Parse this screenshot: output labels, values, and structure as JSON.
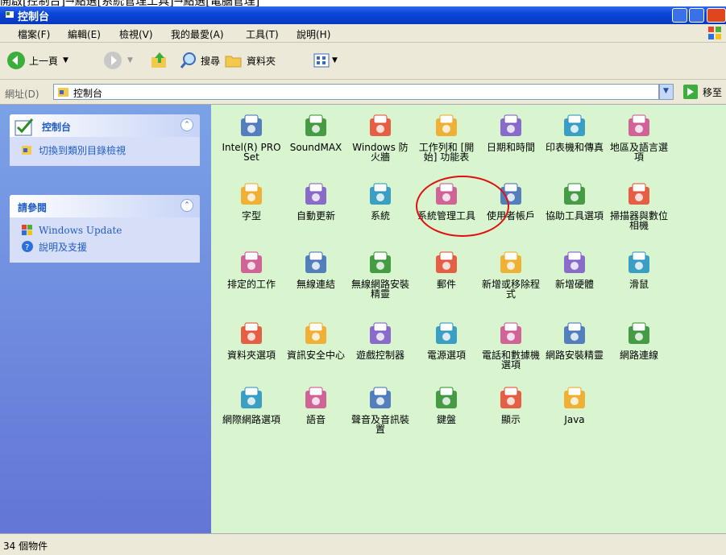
{
  "caption": "開啟[控制台]→點選[系統管理工具]→點選[電腦管理]",
  "window": {
    "title": "控制台"
  },
  "menu": [
    "檔案(F)",
    "編輯(E)",
    "檢視(V)",
    "我的最愛(A)",
    "工具(T)",
    "說明(H)"
  ],
  "toolbar": {
    "back": "上一頁",
    "search": "搜尋",
    "folders": "資料夾"
  },
  "address": {
    "label": "網址(D)",
    "value": "控制台",
    "go": "移至"
  },
  "left": {
    "panel1": {
      "title": "控制台",
      "tasks": [
        "切換到類別目錄檢視"
      ]
    },
    "panel2": {
      "title": "請參閱",
      "tasks": [
        "Windows Update",
        "說明及支援"
      ]
    }
  },
  "icons": [
    [
      "Intel(R) PROSet",
      "SoundMAX",
      "Windows 防火牆",
      "工作列和 [開始] 功能表",
      "日期和時間",
      "印表機和傳真",
      "地區及語言選項"
    ],
    [
      "字型",
      "自動更新",
      "系統",
      "系統管理工具",
      "使用者帳戶",
      "協助工具選項",
      "掃描器與數位相機"
    ],
    [
      "排定的工作",
      "無線連結",
      "無線網路安裝精靈",
      "郵件",
      "新增或移除程式",
      "新增硬體",
      "滑鼠"
    ],
    [
      "資料夾選項",
      "資訊安全中心",
      "遊戲控制器",
      "電源選項",
      "電話和數據機選項",
      "網路安裝精靈",
      "網路連線"
    ],
    [
      "網際網路選項",
      "語音",
      "聲音及音訊裝置",
      "鍵盤",
      "顯示",
      "Java"
    ]
  ],
  "status": {
    "text": "34 個物件"
  },
  "colors": {
    "content_bg": "#d8f5d0",
    "titlebar": "#0a46d8",
    "highlight": "#e01010"
  }
}
